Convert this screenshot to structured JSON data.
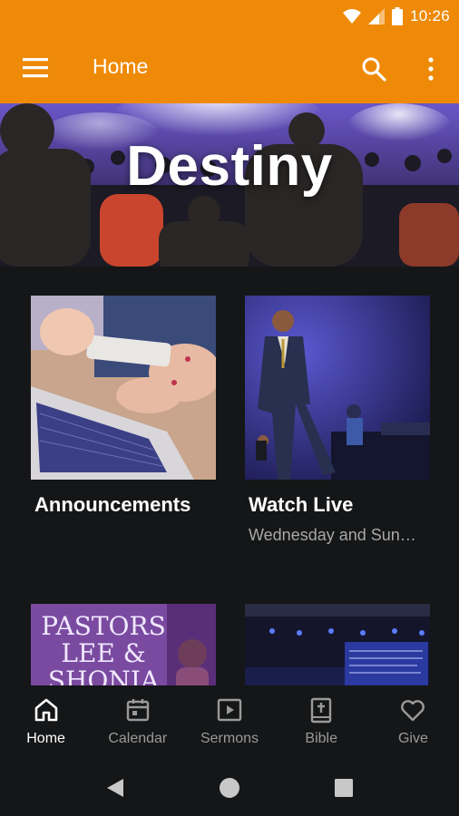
{
  "status_bar": {
    "time": "10:26",
    "icons": [
      "wifi-icon",
      "signal-icon",
      "battery-icon"
    ]
  },
  "app_bar": {
    "title": "Home",
    "background_color": "#ef8a08",
    "icons": [
      "menu-icon",
      "search-icon",
      "more-vert-icon"
    ]
  },
  "hero": {
    "title": "Destiny"
  },
  "tiles": [
    {
      "title": "Announcements",
      "subtitle": ""
    },
    {
      "title": "Watch Live",
      "subtitle": "Wednesday and Sun…"
    },
    {
      "title": "",
      "subtitle": "",
      "image_text": "PASTORS LEE & SHONIA"
    },
    {
      "title": "",
      "subtitle": ""
    }
  ],
  "bottom_nav": {
    "items": [
      {
        "label": "Home",
        "icon": "home-icon",
        "active": true
      },
      {
        "label": "Calendar",
        "icon": "calendar-icon",
        "active": false
      },
      {
        "label": "Sermons",
        "icon": "sermons-icon",
        "active": false
      },
      {
        "label": "Bible",
        "icon": "bible-icon",
        "active": false
      },
      {
        "label": "Give",
        "icon": "heart-icon",
        "active": false
      }
    ]
  },
  "system_nav": {
    "buttons": [
      "back-icon",
      "home-circle-icon",
      "recents-icon"
    ]
  }
}
